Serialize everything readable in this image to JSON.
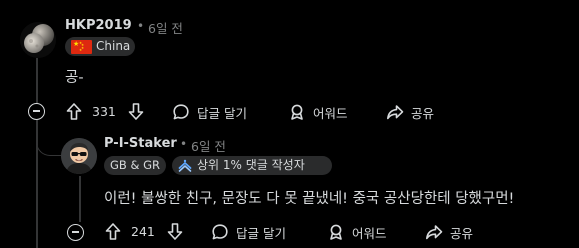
{
  "comments": [
    {
      "username": "HKP2019",
      "separator": "•",
      "time": "6일 전",
      "flair": "China",
      "body": "공-",
      "actions": {
        "votes": "331",
        "reply": "답글 달기",
        "award": "어워드",
        "share": "공유"
      }
    },
    {
      "username": "P-I-Staker",
      "separator": "•",
      "time": "6일 전",
      "flair_tag": "GB & GR",
      "badge": "상위 1% 댓글 작성자",
      "body": "이런! 불쌍한 친구, 문장도 다 못 끝냈네! 중국 공산당한테 당했구먼!",
      "actions": {
        "votes": "241",
        "reply": "답글 달기",
        "award": "어워드",
        "share": "공유"
      }
    }
  ],
  "colors": {
    "background": "#000000",
    "text": "#d7dadc",
    "muted": "#818384",
    "thread_line": "#343536",
    "flair_bg": "#2a2b2c",
    "badge_icon": "#5ea8ff"
  },
  "icons": {
    "upvote": "arrow-up-icon",
    "downvote": "arrow-down-icon",
    "reply": "speech-bubble-icon",
    "award": "award-ribbon-icon",
    "share": "share-arrow-icon",
    "collapse": "minus-circle-icon",
    "badge": "top-commenter-icon"
  }
}
